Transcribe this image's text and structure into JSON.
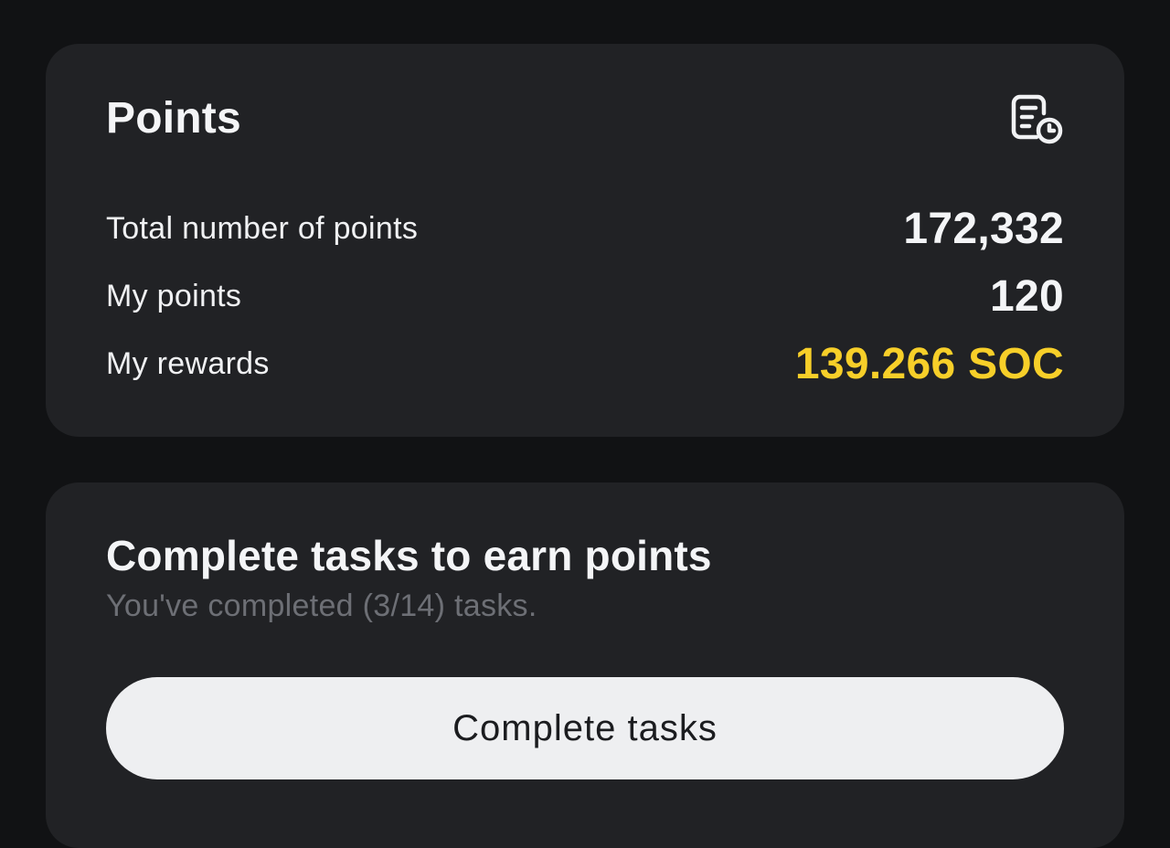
{
  "points_card": {
    "title": "Points",
    "history_icon": "document-clock-icon",
    "rows": [
      {
        "label": "Total number of points",
        "value": "172,332"
      },
      {
        "label": "My points",
        "value": "120"
      },
      {
        "label": "My rewards",
        "value": "139.266 SOC"
      }
    ]
  },
  "tasks_card": {
    "title": "Complete tasks to earn points",
    "subtitle": "You've completed (3/14) tasks.",
    "button_label": "Complete tasks"
  },
  "colors": {
    "background": "#111214",
    "card": "#212225",
    "reward_accent": "#f7cf29",
    "button": "#eeeff1"
  }
}
